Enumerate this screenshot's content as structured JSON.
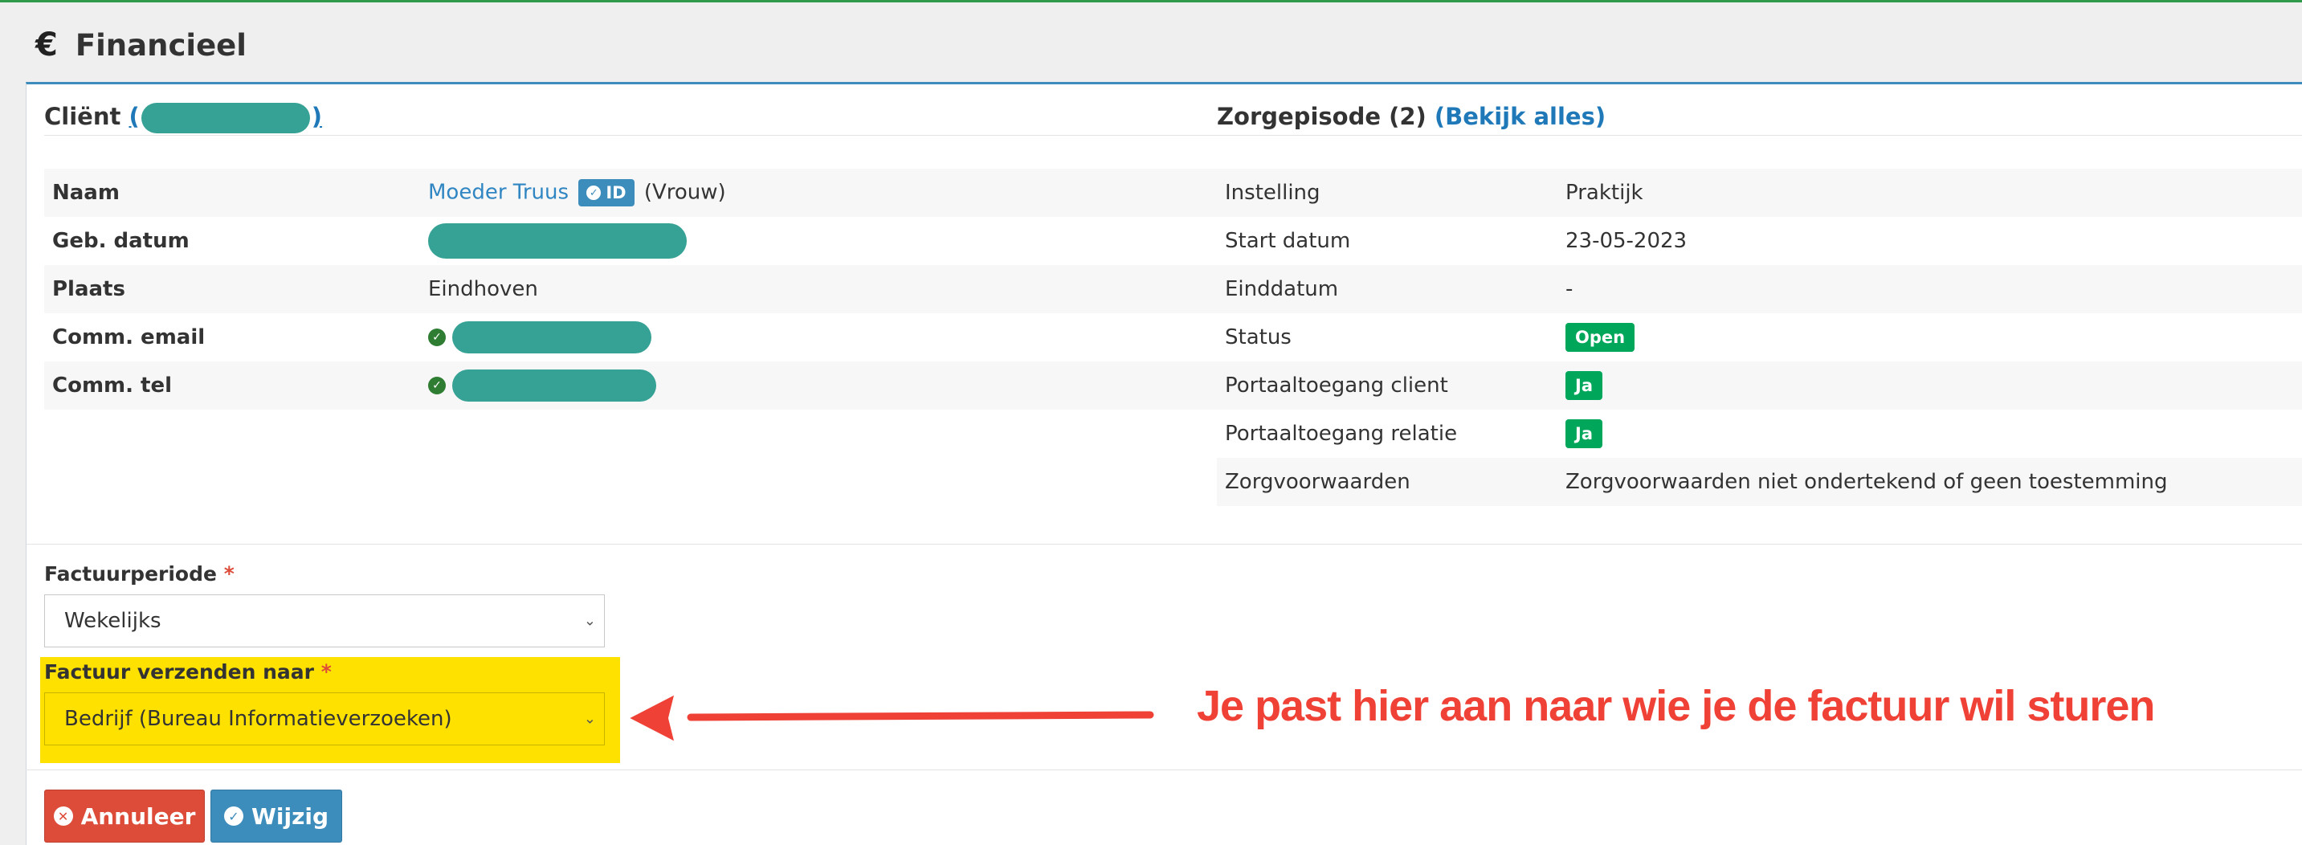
{
  "page": {
    "title": "Financieel",
    "icon": "euro-icon"
  },
  "client_section": {
    "title": "Cliënt",
    "link_open": "(",
    "link_close": ")",
    "rows": [
      {
        "key": "Naam",
        "name": "Moeder Truus",
        "badge": "ID",
        "suffix": "(Vrouw)"
      },
      {
        "key": "Geb. datum"
      },
      {
        "key": "Plaats",
        "value": "Eindhoven"
      },
      {
        "key": "Comm. email"
      },
      {
        "key": "Comm. tel"
      }
    ]
  },
  "episode_section": {
    "title": "Zorgepisode (2)",
    "link": "(Bekijk alles)",
    "rows": [
      {
        "key": "Instelling",
        "value": "Praktijk"
      },
      {
        "key": "Start datum",
        "value": "23-05-2023"
      },
      {
        "key": "Einddatum",
        "value": "-"
      },
      {
        "key": "Status",
        "value": "Open"
      },
      {
        "key": "Portaaltoegang client",
        "value": "Ja"
      },
      {
        "key": "Portaaltoegang relatie",
        "value": "Ja"
      },
      {
        "key": "Zorgvoorwaarden",
        "value": "Zorgvoorwaarden niet ondertekend of geen toestemming"
      }
    ]
  },
  "form": {
    "period_label": "Factuurperiode",
    "period_value": "Wekelijks",
    "send_label": "Factuur verzenden naar",
    "send_value": "Bedrijf (Bureau Informatieverzoeken)",
    "required_mark": "*"
  },
  "buttons": {
    "cancel": "Annuleer",
    "save": "Wijzig"
  },
  "annotation": {
    "text": "Je past hier aan naar wie je de factuur wil sturen",
    "color": "#ef4136"
  },
  "colors": {
    "primary": "#3c8dbc",
    "success": "#00a65a",
    "danger": "#dd4b39",
    "highlight": "#ffe100",
    "redaction": "#36a295"
  }
}
